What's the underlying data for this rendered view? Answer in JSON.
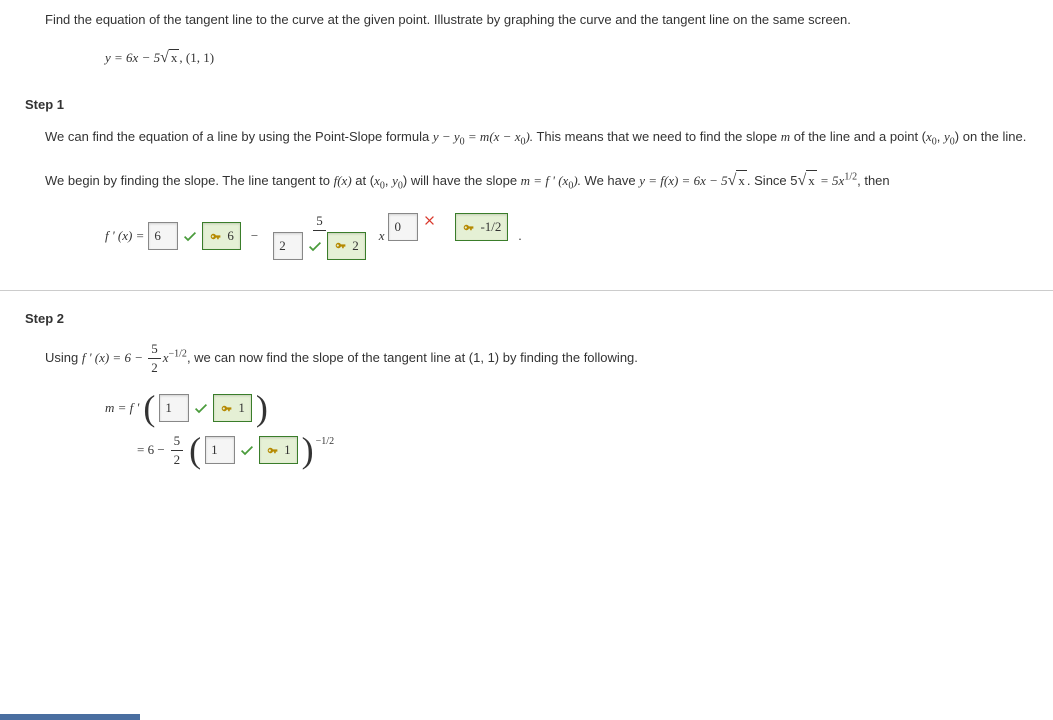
{
  "problem": {
    "text": "Find the equation of the tangent line to the curve at the given point. Illustrate by graphing the curve and the tangent line on the same screen.",
    "equation_prefix": "y = 6x − 5",
    "equation_radicand": "x",
    "equation_suffix": ",   (1, 1)"
  },
  "step1": {
    "title": "Step 1",
    "para1a": "We can find the equation of a line by using the Point-Slope formula  ",
    "para1_formula": "y − y",
    "para1_sub0a": "0",
    "para1b": " = m(x − x",
    "para1_sub0b": "0",
    "para1c": ").",
    "para1d": "  This means that we need to find the slope ",
    "para1_m": "m",
    "para1e": " of the line and a point  (",
    "para1_x0": "x",
    "para1_sub0c": "0",
    "para1f": ", ",
    "para1_y0": "y",
    "para1_sub0d": "0",
    "para1g": ")  on the line.",
    "para2a": "We begin by finding the slope. The line tangent to ",
    "para2_fx": "f(x)",
    "para2b": " at  (",
    "para2_x0": "x",
    "para2s0a": "0",
    "para2c": ", ",
    "para2_y0": "y",
    "para2s0b": "0",
    "para2d": ")  will have the slope  ",
    "para2_m": "m = f ' (x",
    "para2s0c": "0",
    "para2e": ").",
    "para2f": "  We have  ",
    "para2_eq1a": "y = f(x) = 6x − 5",
    "para2_rad1": "x",
    "para2g": ". Since  5",
    "para2_rad2": "x",
    "para2h": " = 5x",
    "para2_exp": "1/2",
    "para2i": ",  then",
    "fprime_label": "f ' (x)  =  ",
    "ans1": "6",
    "hint1": "6",
    "minus": "−",
    "frac_num": "5",
    "ans2": "2",
    "hint2": "2",
    "x_label": "x",
    "ans3": "0",
    "hint3": "-1/2",
    "dot": "."
  },
  "step2": {
    "title": "Step 2",
    "para1a": "Using  ",
    "para1_eq": "f ' (x) = 6 − ",
    "para1_frac_num": "5",
    "para1_frac_den": "2",
    "para1_x": "x",
    "para1_exp": "−1/2",
    "para1b": ",  we can now find the slope of the tangent line at (1, 1) by finding the following.",
    "line1_label": "m  =  f ' ",
    "line1_ans": "1",
    "line1_hint": "1",
    "line2_prefix": "=  6 − ",
    "line2_frac_num": "5",
    "line2_frac_den": "2",
    "line2_ans": "1",
    "line2_hint": "1",
    "line2_exp": "−1/2"
  }
}
